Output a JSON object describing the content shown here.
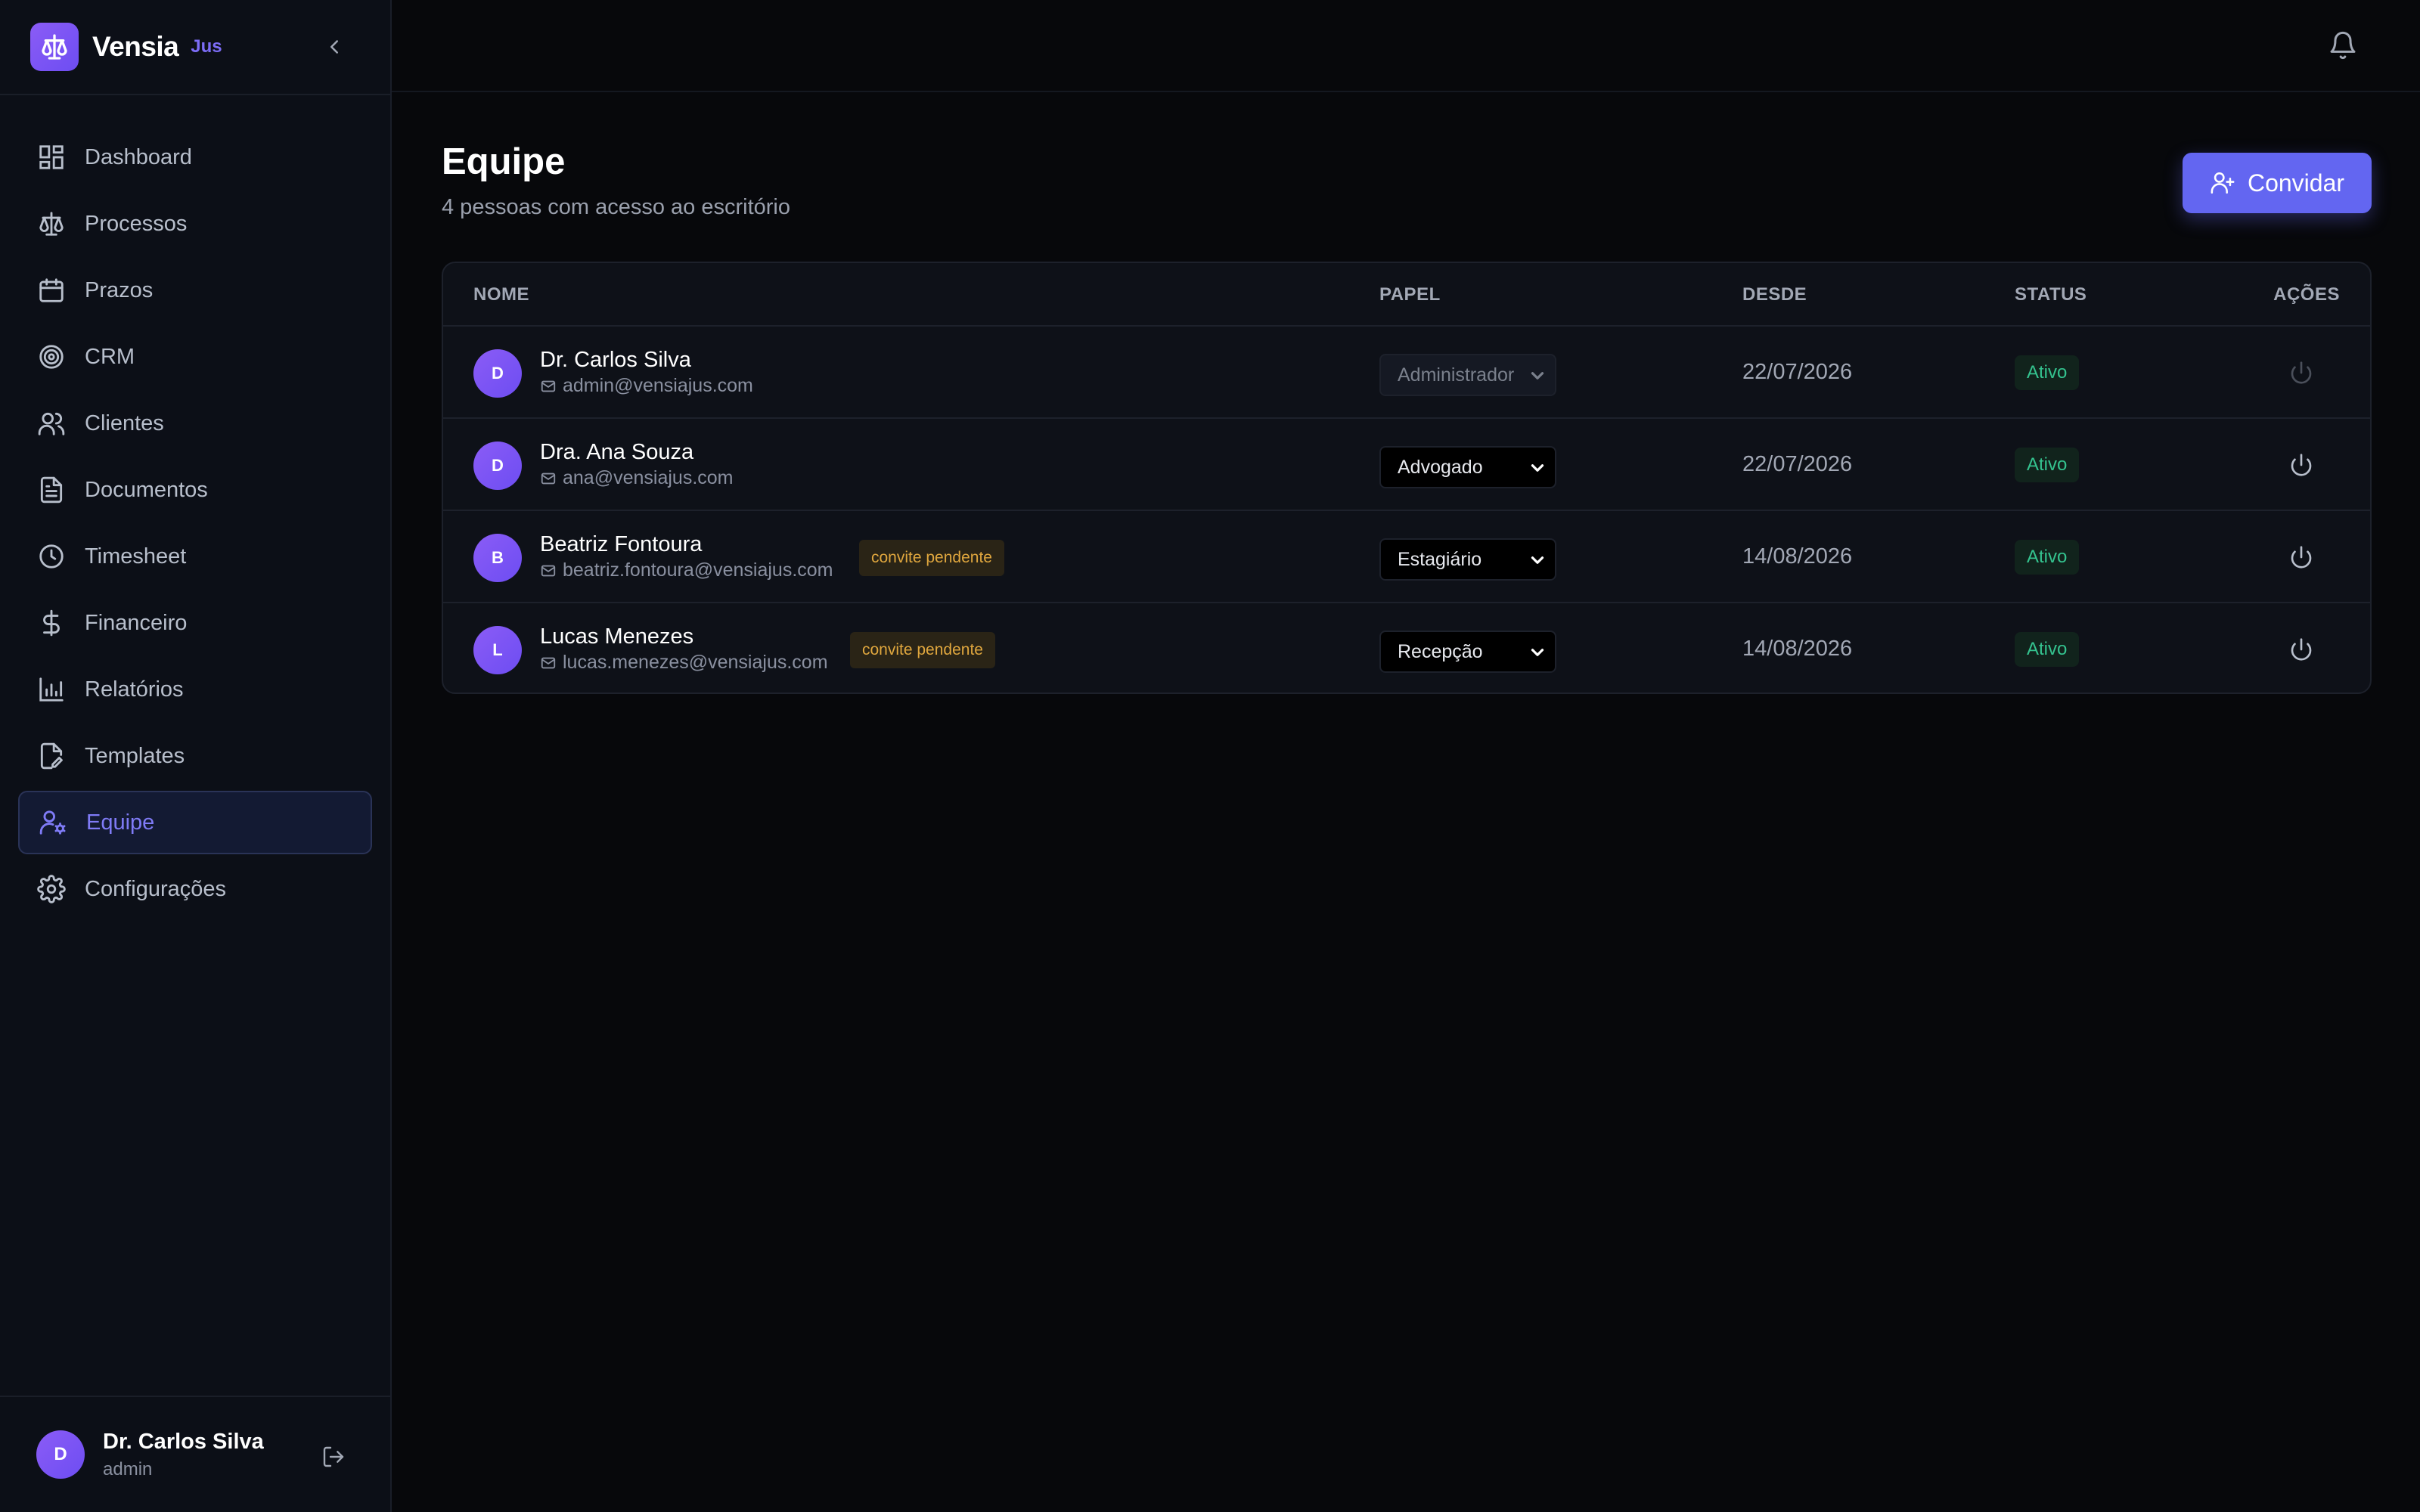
{
  "brand": {
    "name": "Vensia",
    "sub": "Jus"
  },
  "nav": [
    {
      "label": "Dashboard",
      "icon": "dashboard-icon"
    },
    {
      "label": "Processos",
      "icon": "scale-icon"
    },
    {
      "label": "Prazos",
      "icon": "calendar-icon"
    },
    {
      "label": "CRM",
      "icon": "target-icon"
    },
    {
      "label": "Clientes",
      "icon": "users-icon"
    },
    {
      "label": "Documentos",
      "icon": "document-icon"
    },
    {
      "label": "Timesheet",
      "icon": "clock-icon"
    },
    {
      "label": "Financeiro",
      "icon": "dollar-icon"
    },
    {
      "label": "Relatórios",
      "icon": "bar-chart-icon"
    },
    {
      "label": "Templates",
      "icon": "file-edit-icon"
    },
    {
      "label": "Equipe",
      "icon": "user-cog-icon",
      "active": true
    },
    {
      "label": "Configurações",
      "icon": "gear-icon"
    }
  ],
  "user": {
    "initial": "D",
    "name": "Dr. Carlos Silva",
    "role": "admin"
  },
  "page": {
    "title": "Equipe",
    "subtitle": "4 pessoas com acesso ao escritório",
    "invite_label": "Convidar"
  },
  "table": {
    "headers": {
      "name": "NOME",
      "role": "PAPEL",
      "since": "DESDE",
      "status": "STATUS",
      "actions": "AÇÕES"
    },
    "rows": [
      {
        "initial": "D",
        "name": "Dr. Carlos Silva",
        "email": "admin@vensiajus.com",
        "pending": "",
        "role": "Administrador",
        "role_disabled": true,
        "since": "22/07/2026",
        "status": "Ativo"
      },
      {
        "initial": "D",
        "name": "Dra. Ana Souza",
        "email": "ana@vensiajus.com",
        "pending": "",
        "role": "Advogado",
        "role_disabled": false,
        "since": "22/07/2026",
        "status": "Ativo"
      },
      {
        "initial": "B",
        "name": "Beatriz Fontoura",
        "email": "beatriz.fontoura@vensiajus.com",
        "pending": "convite pendente",
        "role": "Estagiário",
        "role_disabled": false,
        "since": "14/08/2026",
        "status": "Ativo"
      },
      {
        "initial": "L",
        "name": "Lucas Menezes",
        "email": "lucas.menezes@vensiajus.com",
        "pending": "convite pendente",
        "role": "Recepção",
        "role_disabled": false,
        "since": "14/08/2026",
        "status": "Ativo"
      }
    ]
  },
  "colors": {
    "accent": "#6366f1",
    "status": "#34c38f",
    "pending": "#e0a73e",
    "background": "#07080b",
    "sidebar": "#0c0f17"
  }
}
